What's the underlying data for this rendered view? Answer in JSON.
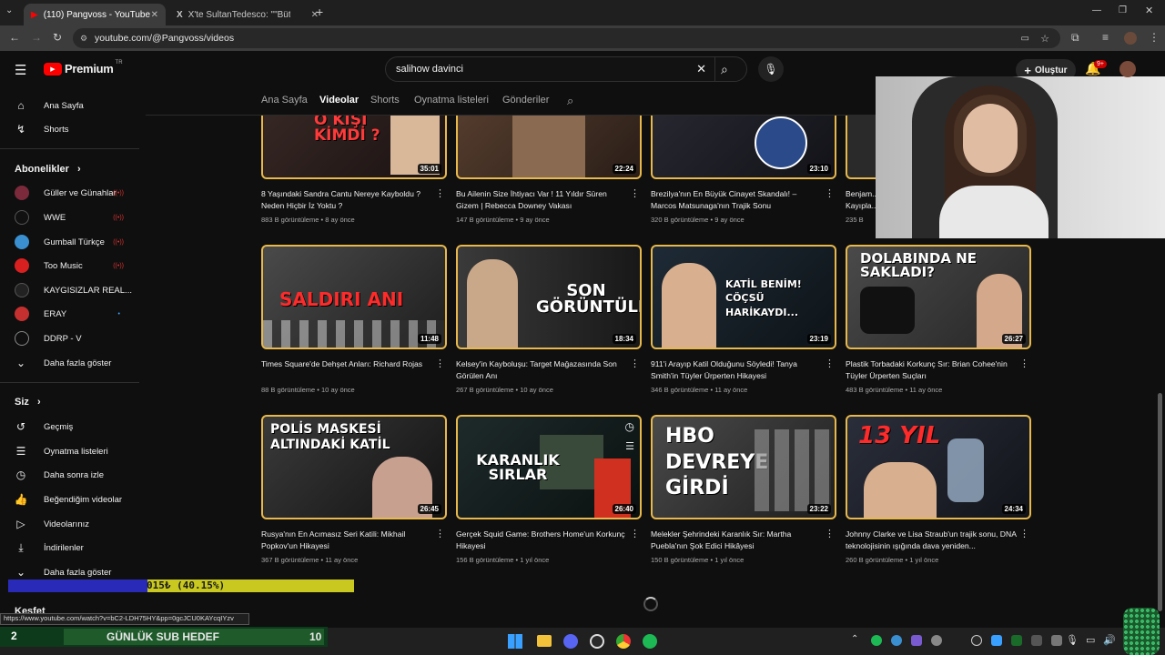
{
  "browser": {
    "tabs": [
      {
        "title": "(110) Pangvoss - YouTube"
      },
      {
        "title": "X'te SultanTedesco: \"\"Bütün Fe..."
      }
    ],
    "url": "youtube.com/@Pangvoss/videos"
  },
  "header": {
    "logo": "Premium",
    "region": "TR",
    "search_value": "salihow davinci",
    "create_label": "Oluştur",
    "notif_count": "9+"
  },
  "sidebar": {
    "main": [
      {
        "label": "Ana Sayfa",
        "icon": "home-icon"
      },
      {
        "label": "Shorts",
        "icon": "shorts-icon"
      }
    ],
    "subs_title": "Abonelikler",
    "subs": [
      {
        "label": "Güller ve Günahlar",
        "color": "#7a2a3a",
        "live": true
      },
      {
        "label": "WWE",
        "color": "#111111",
        "live": true
      },
      {
        "label": "Gumball Türkçe",
        "color": "#3a8fd0",
        "live": true
      },
      {
        "label": "Too Music",
        "color": "#d92020",
        "live": true
      },
      {
        "label": "KAYGISIZLAR REAL...",
        "color": "#222222",
        "live": false
      },
      {
        "label": "ERAY",
        "color": "#c43030",
        "live": false
      },
      {
        "label": "DDRP - V",
        "color": "#0f0f0f",
        "live": false
      }
    ],
    "more_label": "Daha fazla göster",
    "you_title": "Siz",
    "you": [
      {
        "label": "Geçmiş",
        "icon": "history-icon"
      },
      {
        "label": "Oynatma listeleri",
        "icon": "playlist-icon"
      },
      {
        "label": "Daha sonra izle",
        "icon": "clock-icon"
      },
      {
        "label": "Beğendiğim videolar",
        "icon": "like-icon"
      },
      {
        "label": "Videolarınız",
        "icon": "video-icon"
      },
      {
        "label": "İndirilenler",
        "icon": "download-icon"
      }
    ],
    "more_label_2": "Daha fazla göster",
    "explore_title": "Keşfet"
  },
  "channel_tabs": [
    "Ana Sayfa",
    "Videolar",
    "Shorts",
    "Oynatma listeleri",
    "Gönderiler"
  ],
  "videos": [
    {
      "title": "8 Yaşındaki Sandra Cantu Nereye Kayboldu ? Neden Hiçbir İz Yoktu ?",
      "views": "883 B görüntüleme",
      "age": "8 ay önce",
      "duration": "35:01",
      "thumb_text": "O KİŞİ KİMDİ ?",
      "bg": "#3a2a26"
    },
    {
      "title": "Bu Ailenin Size İhtiyacı Var ! 11 Yıldır Süren Gizem | Rebecca Downey Vakası",
      "views": "147 B görüntüleme",
      "age": "9 ay önce",
      "duration": "22:24",
      "thumb_text": "",
      "bg": "#4a3a30"
    },
    {
      "title": "Brezilya'nın En Büyük Cinayet Skandalı! – Marcos Matsunaga'nın Trajik Sonu",
      "views": "320 B görüntüleme",
      "age": "9 ay önce",
      "duration": "23:10",
      "thumb_text": "",
      "bg": "#2a2a34"
    },
    {
      "title": "Times Square'de Dehşet Anları: Richard Rojas",
      "views": "88 B görüntüleme",
      "age": "10 ay önce",
      "duration": "11:48",
      "thumb_text": "SALDIRI ANI",
      "bg": "#3a3a3a"
    },
    {
      "title": "Kelsey'in Kayboluşu: Target Mağazasında Son Görülen Anı",
      "views": "267 B görüntüleme",
      "age": "10 ay önce",
      "duration": "18:34",
      "thumb_text": "SON GÖRÜNTÜLERI",
      "bg": "#2a2a2a"
    },
    {
      "title": "911'i Arayıp Katil Olduğunu Söyledi! Tanya Smith'in Tüyler Ürperten Hikayesi",
      "views": "346 B görüntüleme",
      "age": "11 ay önce",
      "duration": "23:19",
      "thumb_text": "KATİL BENİM! CÖÇSÜ HARİKAYDI...",
      "bg": "#1e2a36"
    },
    {
      "title": "Plastik Torbadaki Korkunç Sır: Brian Cohee'nin Tüyler Ürperten Suçları",
      "views": "483 B görüntüleme",
      "age": "11 ay önce",
      "duration": "26:27",
      "thumb_text": "DOLABINDA NE SAKLADI?",
      "bg": "#3a3a3a"
    },
    {
      "title": "Rusya'nın En Acımasız Seri Katili: Mikhail Popkov'un Hikayesi",
      "views": "367 B görüntüleme",
      "age": "11 ay önce",
      "duration": "26:45",
      "thumb_text": "POLİS MASKESİ ALTINDAKİ KATİL",
      "bg": "#2e2e2e"
    },
    {
      "title": "Gerçek Squid Game: Brothers Home'un Korkunç Hikayesi",
      "views": "156 B görüntüleme",
      "age": "1 yıl önce",
      "duration": "26:40",
      "thumb_text": "KARANLIK SIRLAR",
      "bg": "#1e2a2a"
    },
    {
      "title": "Melekler Şehrindeki Karanlık Sır: Martha Puebla'nın Şok Edici Hikâyesi",
      "views": "150 B görüntüleme",
      "age": "1 yıl önce",
      "duration": "23:22",
      "thumb_text": "HBO DEVREYE GİRDİ",
      "bg": "#3a3a3a"
    },
    {
      "title": "Johnny Clarke ve Lisa Straub'un trajik sonu, DNA teknolojisinin ışığında dava yeniden...",
      "views": "260 B görüntüleme",
      "age": "1 yıl önce",
      "duration": "24:34",
      "thumb_text": "13 YIL",
      "bg": "#2a2e3a"
    }
  ],
  "partial_video": {
    "title": "Benjam... Kayıpla...",
    "views": "235 B"
  },
  "overlays": {
    "progress_text": "015₺ (40.15%)",
    "progress_fraction": 0.4015,
    "goal_count": "2",
    "goal_label": "GÜNLÜK SUB HEDEF",
    "goal_target": "10",
    "status_url": "https://www.youtube.com/watch?v=bC2-LDH75HY&pp=0gcJCU0KAYcqIYzv"
  },
  "colors": {
    "accent_red": "#ff0000",
    "thumb_border": "#e8b84b",
    "bg": "#0f0f0f"
  }
}
